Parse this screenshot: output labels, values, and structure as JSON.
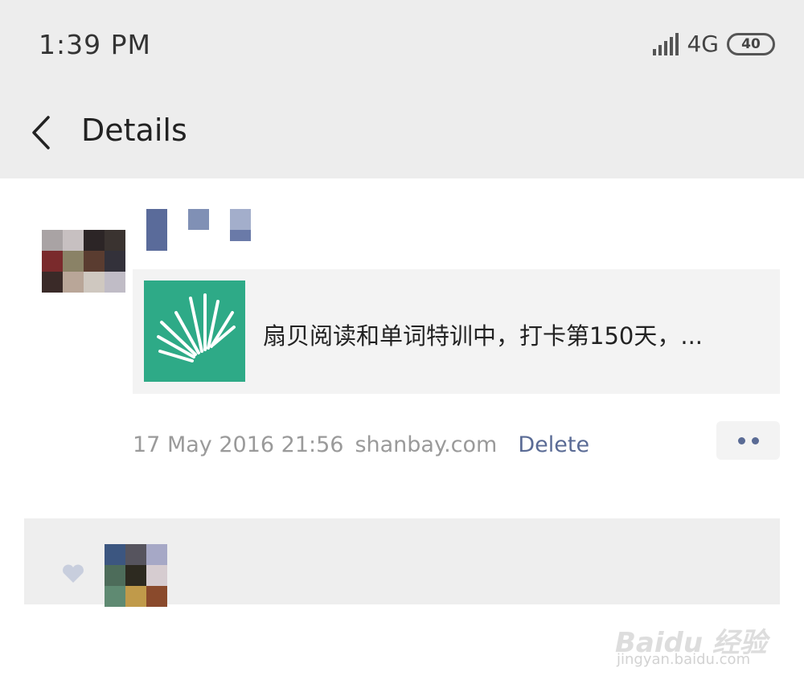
{
  "status_bar": {
    "time": "1:39 PM",
    "network": "4G",
    "battery": "40"
  },
  "nav": {
    "title": "Details",
    "back_icon": "chevron-left-icon"
  },
  "post": {
    "share": {
      "thumbnail_icon": "shanbay-logo-icon",
      "thumbnail_color": "#2eaa87",
      "text": "扇贝阅读和单词特训中，打卡第150天，..."
    },
    "meta": {
      "time": "17 May 2016 21:56",
      "source": "shanbay.com",
      "delete_label": "Delete"
    },
    "more_icon": "more-dots-icon",
    "accent_color": "#5a6b95"
  },
  "watermark": {
    "main": "Baidu 经验",
    "sub": "jingyan.baidu.com"
  }
}
